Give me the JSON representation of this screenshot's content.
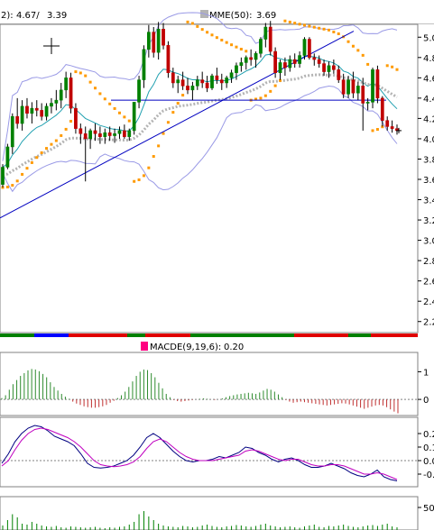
{
  "header": {
    "left_label": "2):",
    "left_value_1": "4.67/",
    "left_value_2": "3.39",
    "mme_label": "MME(50):",
    "mme_value": "3.69"
  },
  "macd_panel": {
    "label": "MACDE(9,19,6):",
    "value": "0.20"
  },
  "colors": {
    "up": "#008000",
    "down": "#c00000",
    "bollinger": "#9a9ae6",
    "mme_short": "#20a0b0",
    "mme_long": "#b4b4b4",
    "sar": "#ff9a00",
    "trendline": "#0000c0",
    "histogram_up": "#2e8b2e",
    "histogram_down": "#c03030",
    "signal": "#c000c0",
    "macd_line": "#000080",
    "grid_dashed": "#808080"
  },
  "chart_data": [
    {
      "type": "candlestick",
      "panel": "price",
      "y_ticks": [
        "5.0",
        "4.8",
        "4.6",
        "4.4",
        "4.2",
        "4.0",
        "3.8",
        "3.6",
        "3.4",
        "3.2",
        "3.0",
        "2.8",
        "2.6",
        "2.4",
        "2.2"
      ],
      "ylim": [
        2.1,
        5.1
      ],
      "series": [
        {
          "name": "2)",
          "value": 4.67
        },
        {
          "name": "MME(50)",
          "value": 3.69
        }
      ],
      "ohlc": [
        [
          3.55,
          3.75,
          3.52,
          3.72
        ],
        [
          3.72,
          3.95,
          3.7,
          3.92
        ],
        [
          3.92,
          4.25,
          3.85,
          4.22
        ],
        [
          4.22,
          4.4,
          4.1,
          4.15
        ],
        [
          4.15,
          4.38,
          4.08,
          4.32
        ],
        [
          4.32,
          4.4,
          4.2,
          4.25
        ],
        [
          4.25,
          4.36,
          4.15,
          4.3
        ],
        [
          4.3,
          4.38,
          4.22,
          4.28
        ],
        [
          4.28,
          4.35,
          4.18,
          4.22
        ],
        [
          4.22,
          4.35,
          4.18,
          4.32
        ],
        [
          4.32,
          4.4,
          4.25,
          4.35
        ],
        [
          4.35,
          4.48,
          4.28,
          4.38
        ],
        [
          4.38,
          4.55,
          4.3,
          4.48
        ],
        [
          4.48,
          4.66,
          4.4,
          4.6
        ],
        [
          4.6,
          4.65,
          4.25,
          4.3
        ],
        [
          4.3,
          4.35,
          4.05,
          4.1
        ],
        [
          4.1,
          4.15,
          3.95,
          4.05
        ],
        [
          4.05,
          4.12,
          3.58,
          4.0
        ],
        [
          4.0,
          4.1,
          3.9,
          4.08
        ],
        [
          4.08,
          4.15,
          3.98,
          4.05
        ],
        [
          4.05,
          4.12,
          3.95,
          4.02
        ],
        [
          4.02,
          4.1,
          3.95,
          4.06
        ],
        [
          4.06,
          4.12,
          3.98,
          4.03
        ],
        [
          4.03,
          4.1,
          3.96,
          4.05
        ],
        [
          4.05,
          4.12,
          4.0,
          4.08
        ],
        [
          4.08,
          4.14,
          4.0,
          4.02
        ],
        [
          4.02,
          4.1,
          3.98,
          4.08
        ],
        [
          4.08,
          4.36,
          4.04,
          4.36
        ],
        [
          4.36,
          4.62,
          4.3,
          4.58
        ],
        [
          4.58,
          4.92,
          4.5,
          4.88
        ],
        [
          4.88,
          5.12,
          4.8,
          5.05
        ],
        [
          5.05,
          5.1,
          4.8,
          4.85
        ],
        [
          4.85,
          5.15,
          4.78,
          5.08
        ],
        [
          5.08,
          5.14,
          4.88,
          4.92
        ],
        [
          4.92,
          4.96,
          4.6,
          4.65
        ],
        [
          4.65,
          4.7,
          4.5,
          4.55
        ],
        [
          4.55,
          4.62,
          4.45,
          4.58
        ],
        [
          4.58,
          4.66,
          4.48,
          4.52
        ],
        [
          4.52,
          4.6,
          4.44,
          4.48
        ],
        [
          4.48,
          4.56,
          4.38,
          4.52
        ],
        [
          4.52,
          4.62,
          4.48,
          4.58
        ],
        [
          4.58,
          4.66,
          4.5,
          4.55
        ],
        [
          4.55,
          4.62,
          4.46,
          4.5
        ],
        [
          4.5,
          4.64,
          4.48,
          4.62
        ],
        [
          4.62,
          4.7,
          4.54,
          4.58
        ],
        [
          4.58,
          4.64,
          4.48,
          4.55
        ],
        [
          4.55,
          4.62,
          4.5,
          4.6
        ],
        [
          4.6,
          4.68,
          4.55,
          4.65
        ],
        [
          4.65,
          4.75,
          4.58,
          4.72
        ],
        [
          4.72,
          4.8,
          4.66,
          4.75
        ],
        [
          4.75,
          4.82,
          4.68,
          4.8
        ],
        [
          4.8,
          4.88,
          4.72,
          4.78
        ],
        [
          4.78,
          4.86,
          4.7,
          4.84
        ],
        [
          4.84,
          5.0,
          4.8,
          4.98
        ],
        [
          4.98,
          5.14,
          4.9,
          5.1
        ],
        [
          5.1,
          5.16,
          4.82,
          4.86
        ],
        [
          4.86,
          4.9,
          4.6,
          4.65
        ],
        [
          4.65,
          4.78,
          4.58,
          4.75
        ],
        [
          4.75,
          4.8,
          4.62,
          4.7
        ],
        [
          4.7,
          4.82,
          4.66,
          4.78
        ],
        [
          4.78,
          4.84,
          4.7,
          4.74
        ],
        [
          4.74,
          4.86,
          4.7,
          4.82
        ],
        [
          4.82,
          5.0,
          4.78,
          4.98
        ],
        [
          4.98,
          5.0,
          4.78,
          4.8
        ],
        [
          4.8,
          4.84,
          4.72,
          4.78
        ],
        [
          4.78,
          4.82,
          4.7,
          4.74
        ],
        [
          4.74,
          4.78,
          4.62,
          4.66
        ],
        [
          4.66,
          4.76,
          4.6,
          4.72
        ],
        [
          4.72,
          4.78,
          4.64,
          4.68
        ],
        [
          4.68,
          4.72,
          4.55,
          4.58
        ],
        [
          4.58,
          4.64,
          4.4,
          4.44
        ],
        [
          4.44,
          4.62,
          4.4,
          4.58
        ],
        [
          4.58,
          4.66,
          4.4,
          4.45
        ],
        [
          4.45,
          4.56,
          4.38,
          4.52
        ],
        [
          4.52,
          4.6,
          4.08,
          4.35
        ],
        [
          4.35,
          4.4,
          4.28,
          4.36
        ],
        [
          4.36,
          4.7,
          4.3,
          4.68
        ],
        [
          4.68,
          4.72,
          4.35,
          4.4
        ],
        [
          4.4,
          4.42,
          4.12,
          4.18
        ],
        [
          4.18,
          4.22,
          4.08,
          4.12
        ],
        [
          4.12,
          4.18,
          4.06,
          4.1
        ],
        [
          4.1,
          4.14,
          4.04,
          4.08
        ]
      ],
      "markers": [
        "crosshair",
        "cursor-plus"
      ]
    },
    {
      "type": "bar",
      "panel": "macd-histogram",
      "title": "MACDE(9,19,6)",
      "value": 0.2,
      "y_ticks": [
        "1",
        "0"
      ],
      "ylim": [
        -0.55,
        1.6
      ],
      "values": [
        0.05,
        0.15,
        0.35,
        0.55,
        0.7,
        0.85,
        0.95,
        1.05,
        1.1,
        1.08,
        1.02,
        0.92,
        0.8,
        0.62,
        0.45,
        0.32,
        0.2,
        0.1,
        0.02,
        -0.08,
        -0.15,
        -0.2,
        -0.25,
        -0.28,
        -0.3,
        -0.3,
        -0.28,
        -0.25,
        -0.2,
        -0.12,
        -0.05,
        0.05,
        0.15,
        0.28,
        0.45,
        0.65,
        0.85,
        1.0,
        1.08,
        1.06,
        0.95,
        0.8,
        0.6,
        0.4,
        0.2,
        0.08,
        -0.02,
        -0.06,
        -0.08,
        -0.06,
        -0.04,
        -0.02,
        0.0,
        0.02,
        0.04,
        0.02,
        0.0,
        -0.02,
        0.0,
        0.04,
        0.08,
        0.12,
        0.15,
        0.18,
        0.2,
        0.22,
        0.24,
        0.22,
        0.2,
        0.25,
        0.32,
        0.38,
        0.35,
        0.28,
        0.18,
        0.08,
        -0.02,
        -0.08,
        -0.12,
        -0.1,
        -0.08,
        -0.1,
        -0.12,
        -0.14,
        -0.16,
        -0.18,
        -0.2,
        -0.22,
        -0.2,
        -0.18,
        -0.16,
        -0.14,
        -0.15,
        -0.18,
        -0.22,
        -0.26,
        -0.3,
        -0.34,
        -0.3,
        -0.26,
        -0.22,
        -0.2,
        -0.22,
        -0.28,
        -0.36,
        -0.44,
        -0.5
      ]
    },
    {
      "type": "line",
      "panel": "oscillator",
      "y_ticks": [
        "0.2",
        "0.1",
        "0.0",
        "-0.1"
      ],
      "ylim": [
        -0.18,
        0.3
      ],
      "series": [
        {
          "values": [
            -0.02,
            0.05,
            0.14,
            0.2,
            0.24,
            0.26,
            0.25,
            0.22,
            0.18,
            0.16,
            0.14,
            0.11,
            0.05,
            -0.02,
            -0.05,
            -0.055,
            -0.05,
            -0.04,
            -0.02,
            0.0,
            0.04,
            0.1,
            0.17,
            0.2,
            0.17,
            0.12,
            0.07,
            0.03,
            0.0,
            -0.01,
            0.0,
            0.0,
            0.01,
            0.03,
            0.02,
            0.04,
            0.06,
            0.1,
            0.09,
            0.06,
            0.04,
            0.01,
            -0.01,
            0.01,
            0.02,
            0.0,
            -0.03,
            -0.05,
            -0.05,
            -0.04,
            -0.02,
            -0.04,
            -0.06,
            -0.09,
            -0.11,
            -0.12,
            -0.1,
            -0.07,
            -0.12,
            -0.14,
            -0.15
          ]
        },
        {
          "values": [
            -0.04,
            0.0,
            0.08,
            0.15,
            0.2,
            0.23,
            0.24,
            0.23,
            0.21,
            0.19,
            0.17,
            0.14,
            0.1,
            0.05,
            0.0,
            -0.03,
            -0.04,
            -0.045,
            -0.04,
            -0.03,
            -0.01,
            0.03,
            0.09,
            0.14,
            0.16,
            0.14,
            0.1,
            0.06,
            0.03,
            0.01,
            0.0,
            0.0,
            0.0,
            0.01,
            0.02,
            0.03,
            0.04,
            0.07,
            0.08,
            0.07,
            0.05,
            0.03,
            0.01,
            0.0,
            0.01,
            0.01,
            -0.01,
            -0.03,
            -0.04,
            -0.04,
            -0.03,
            -0.03,
            -0.04,
            -0.06,
            -0.08,
            -0.1,
            -0.1,
            -0.09,
            -0.1,
            -0.12,
            -0.14
          ]
        }
      ]
    },
    {
      "type": "bar",
      "panel": "volume",
      "y_ticks": [
        "50"
      ],
      "ylim": [
        0,
        70
      ],
      "values": [
        10,
        22,
        35,
        28,
        14,
        12,
        18,
        14,
        10,
        8,
        7,
        9,
        6,
        5,
        8,
        7,
        6,
        5,
        6,
        7,
        5,
        4,
        6,
        5,
        7,
        8,
        12,
        18,
        35,
        42,
        30,
        22,
        14,
        10,
        8,
        7,
        6,
        9,
        8,
        6,
        7,
        10,
        12,
        9,
        7,
        6,
        8,
        9,
        11,
        10,
        8,
        7,
        9,
        12,
        14,
        10,
        8,
        6,
        7,
        8,
        6,
        5,
        8,
        10,
        12,
        7,
        6,
        9,
        8,
        10,
        12,
        9,
        7,
        6,
        8,
        10,
        11,
        9,
        12,
        14,
        8,
        6
      ]
    }
  ]
}
